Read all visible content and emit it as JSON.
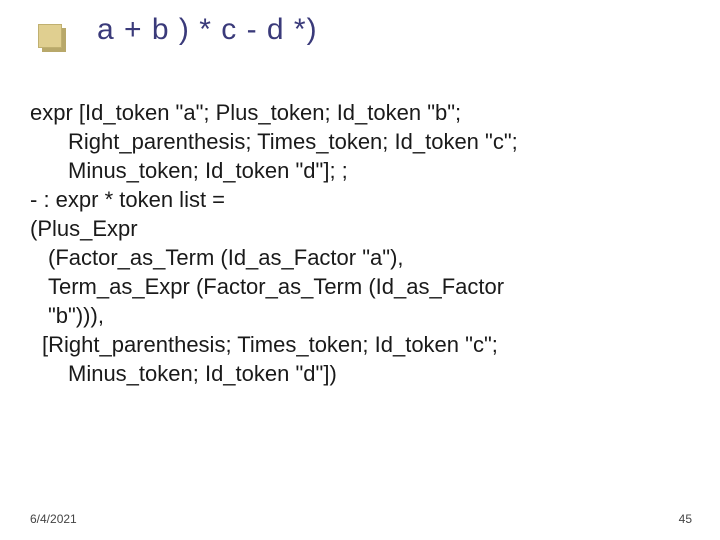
{
  "title": "a + b ) * c - d *)",
  "body": {
    "line1": "expr [Id_token \"a\"; Plus_token; Id_token \"b\";",
    "line2": "Right_parenthesis; Times_token; Id_token \"c\";",
    "line3": "Minus_token; Id_token \"d\"]; ;",
    "line4": "- : expr * token list =",
    "line5": "(Plus_Expr",
    "line6": "(Factor_as_Term (Id_as_Factor \"a\"),",
    "line7": "Term_as_Expr (Factor_as_Term (Id_as_Factor",
    "line8": "\"b\"))),",
    "line9": "[Right_parenthesis; Times_token; Id_token \"c\";",
    "line10": "Minus_token; Id_token \"d\"])"
  },
  "footer": {
    "date": "6/4/2021",
    "page": "45"
  }
}
